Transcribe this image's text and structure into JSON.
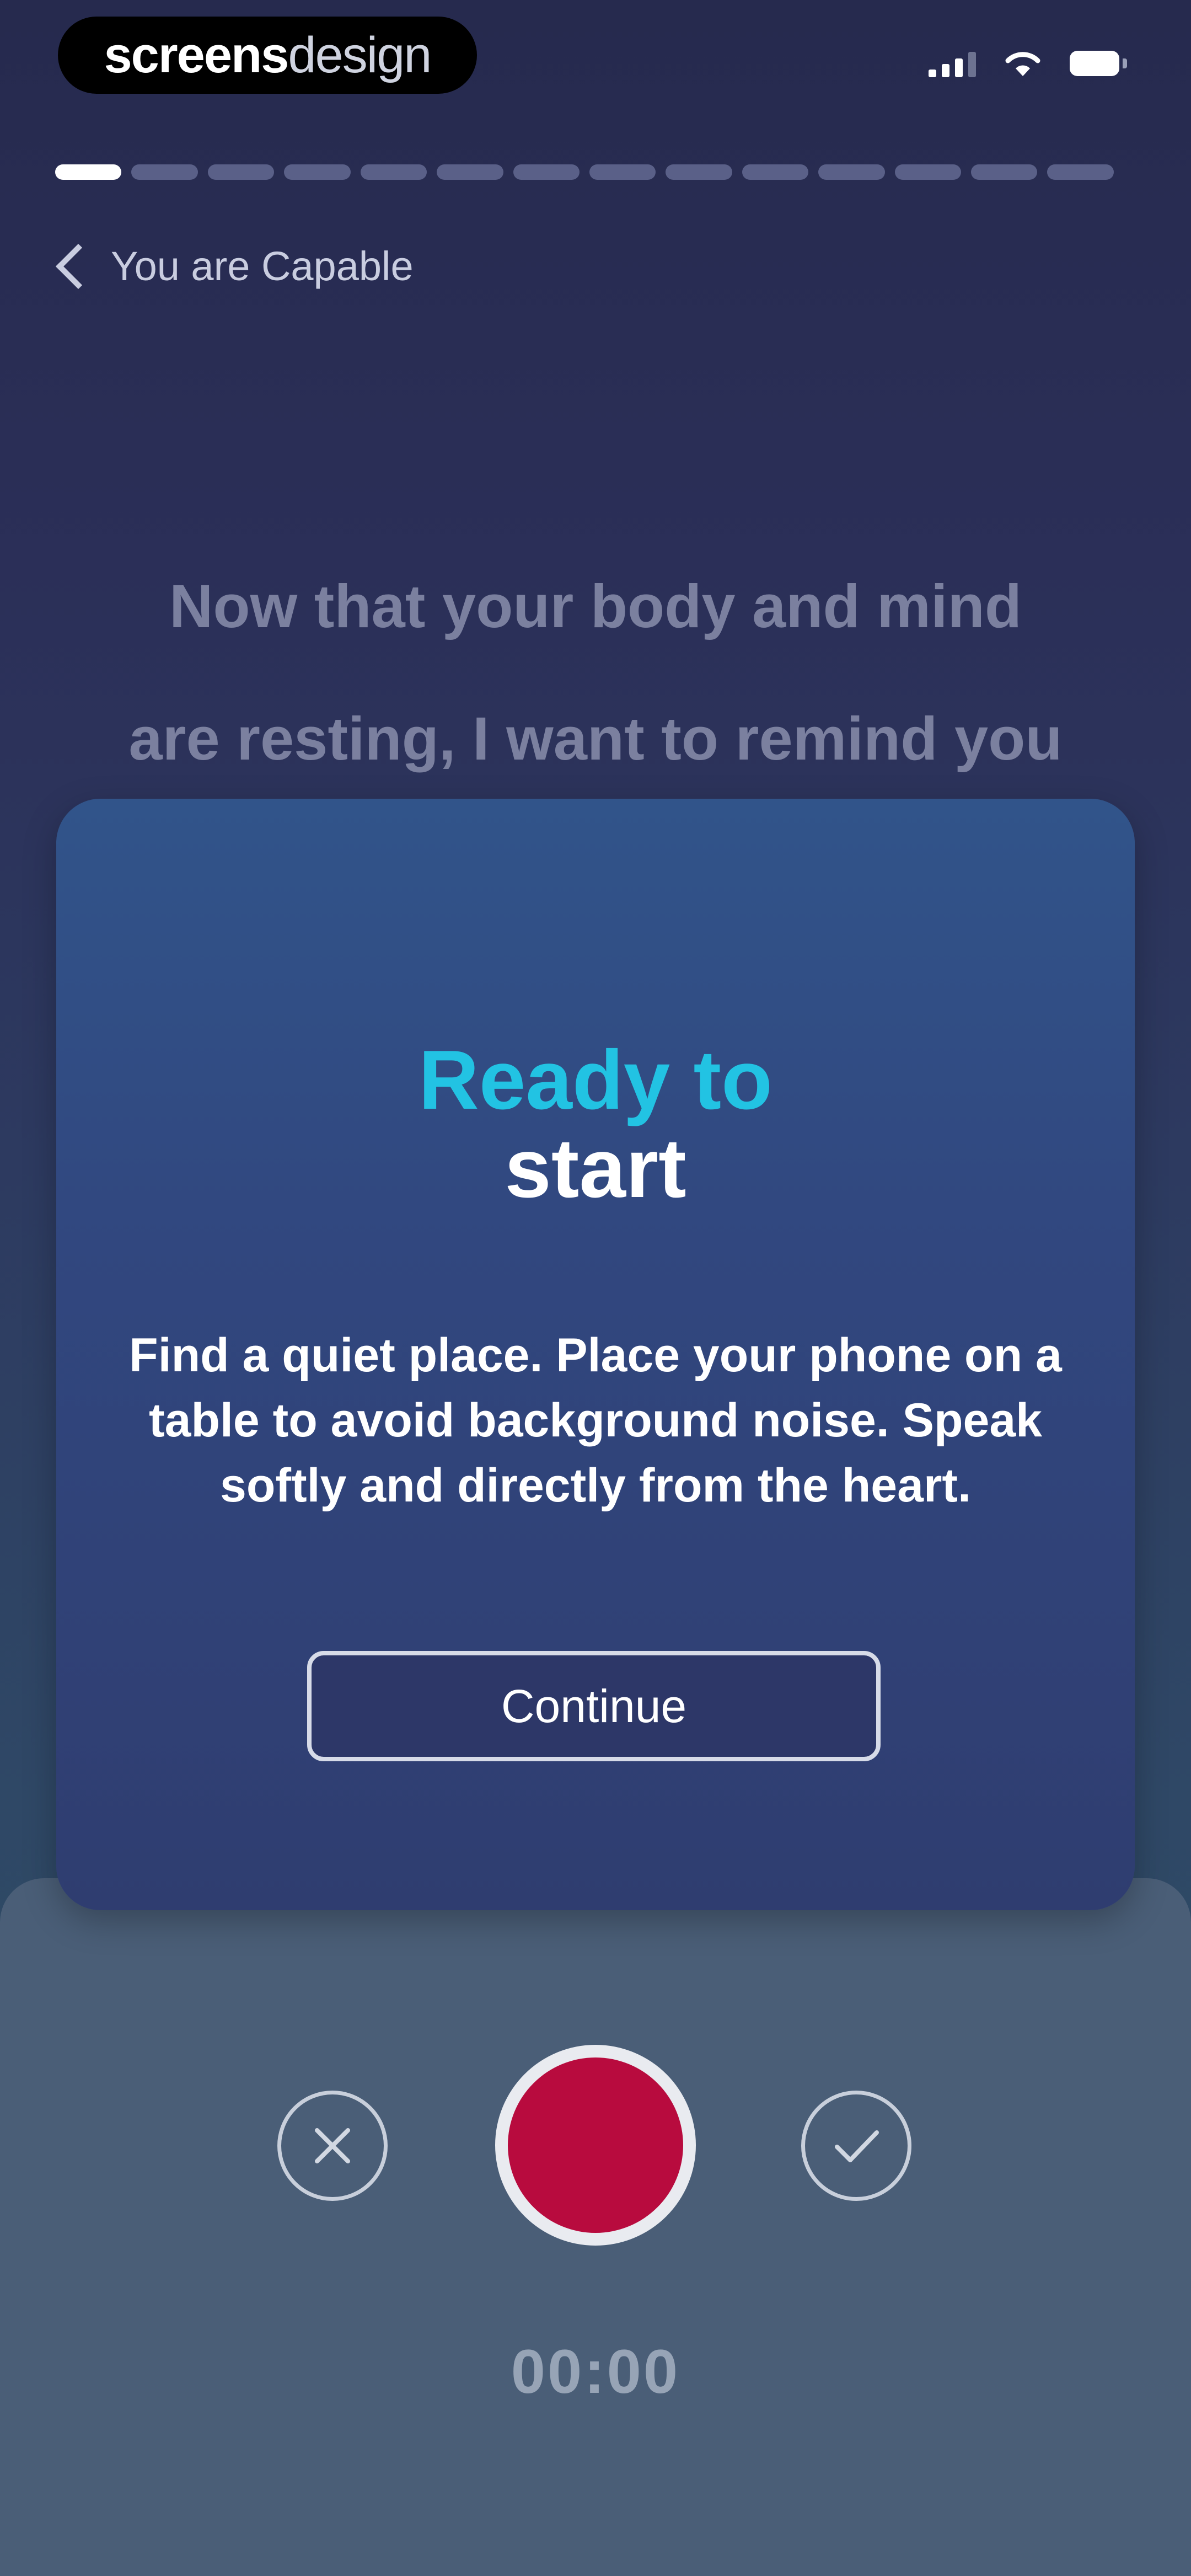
{
  "status_bar": {
    "logo_part1": "screens",
    "logo_part2": "design"
  },
  "progress": {
    "total_segments": 14,
    "completed_segments": 1
  },
  "nav": {
    "back_label": "You are Capable"
  },
  "script": {
    "line1": "Now that your body and mind",
    "line2": "are resting, I want to remind you"
  },
  "modal": {
    "title_line1": "Ready to",
    "title_line2": "start",
    "body": "Find a quiet place. Place your phone on a table to avoid background noise. Speak softly and directly from the heart.",
    "continue_label": "Continue"
  },
  "recorder": {
    "timer": "00:00"
  },
  "colors": {
    "accent_cyan": "#22c3e3",
    "record_red": "#b80b3e",
    "card_blue": "#31477f",
    "panel_slate": "#4a5e77"
  }
}
